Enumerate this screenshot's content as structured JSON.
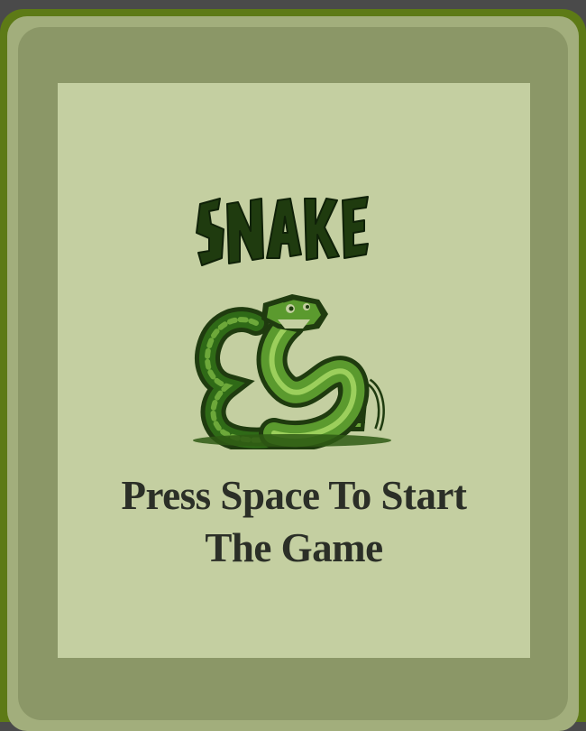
{
  "game": {
    "logo_text": "SNAKE",
    "prompt_line1": "Press Space To Start",
    "prompt_line2": "The Game",
    "logo_icon": "snake-mascot-icon"
  },
  "colors": {
    "screen": "#c4cfa1",
    "dark_green": "#1f3b0f",
    "mid_green": "#2f6a17",
    "light_green": "#6da83a",
    "text": "#2b2f27"
  }
}
